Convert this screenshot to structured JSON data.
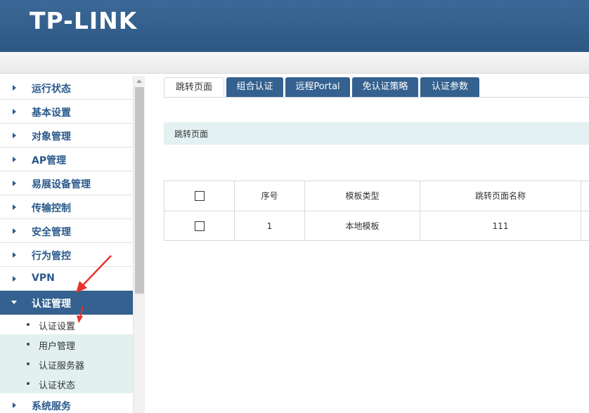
{
  "header": {
    "logo_text": "TP-LINK"
  },
  "sidebar": {
    "items": [
      {
        "label": "运行状态"
      },
      {
        "label": "基本设置"
      },
      {
        "label": "对象管理"
      },
      {
        "label": "AP管理"
      },
      {
        "label": "易展设备管理"
      },
      {
        "label": "传输控制"
      },
      {
        "label": "安全管理"
      },
      {
        "label": "行为管控"
      },
      {
        "label": "VPN"
      },
      {
        "label": "认证管理"
      }
    ],
    "sub_items": [
      {
        "label": "认证设置"
      },
      {
        "label": "用户管理"
      },
      {
        "label": "认证服务器"
      },
      {
        "label": "认证状态"
      }
    ],
    "after_items": [
      {
        "label": "系统服务"
      }
    ]
  },
  "tabs": [
    {
      "label": "跳转页面"
    },
    {
      "label": "组合认证"
    },
    {
      "label": "远程Portal"
    },
    {
      "label": "免认证策略"
    },
    {
      "label": "认证参数"
    }
  ],
  "section": {
    "title": "跳转页面"
  },
  "table": {
    "columns": [
      "序号",
      "模板类型",
      "跳转页面名称"
    ],
    "rows": [
      {
        "index": "1",
        "template_type": "本地模板",
        "page_name": "111"
      }
    ]
  },
  "colors": {
    "header_blue": "#2d5884",
    "menu_text": "#2b5a8b",
    "active_menu_bg": "#34618f",
    "section_bg": "#e4f1f2",
    "annotation_red": "#e8322d"
  }
}
